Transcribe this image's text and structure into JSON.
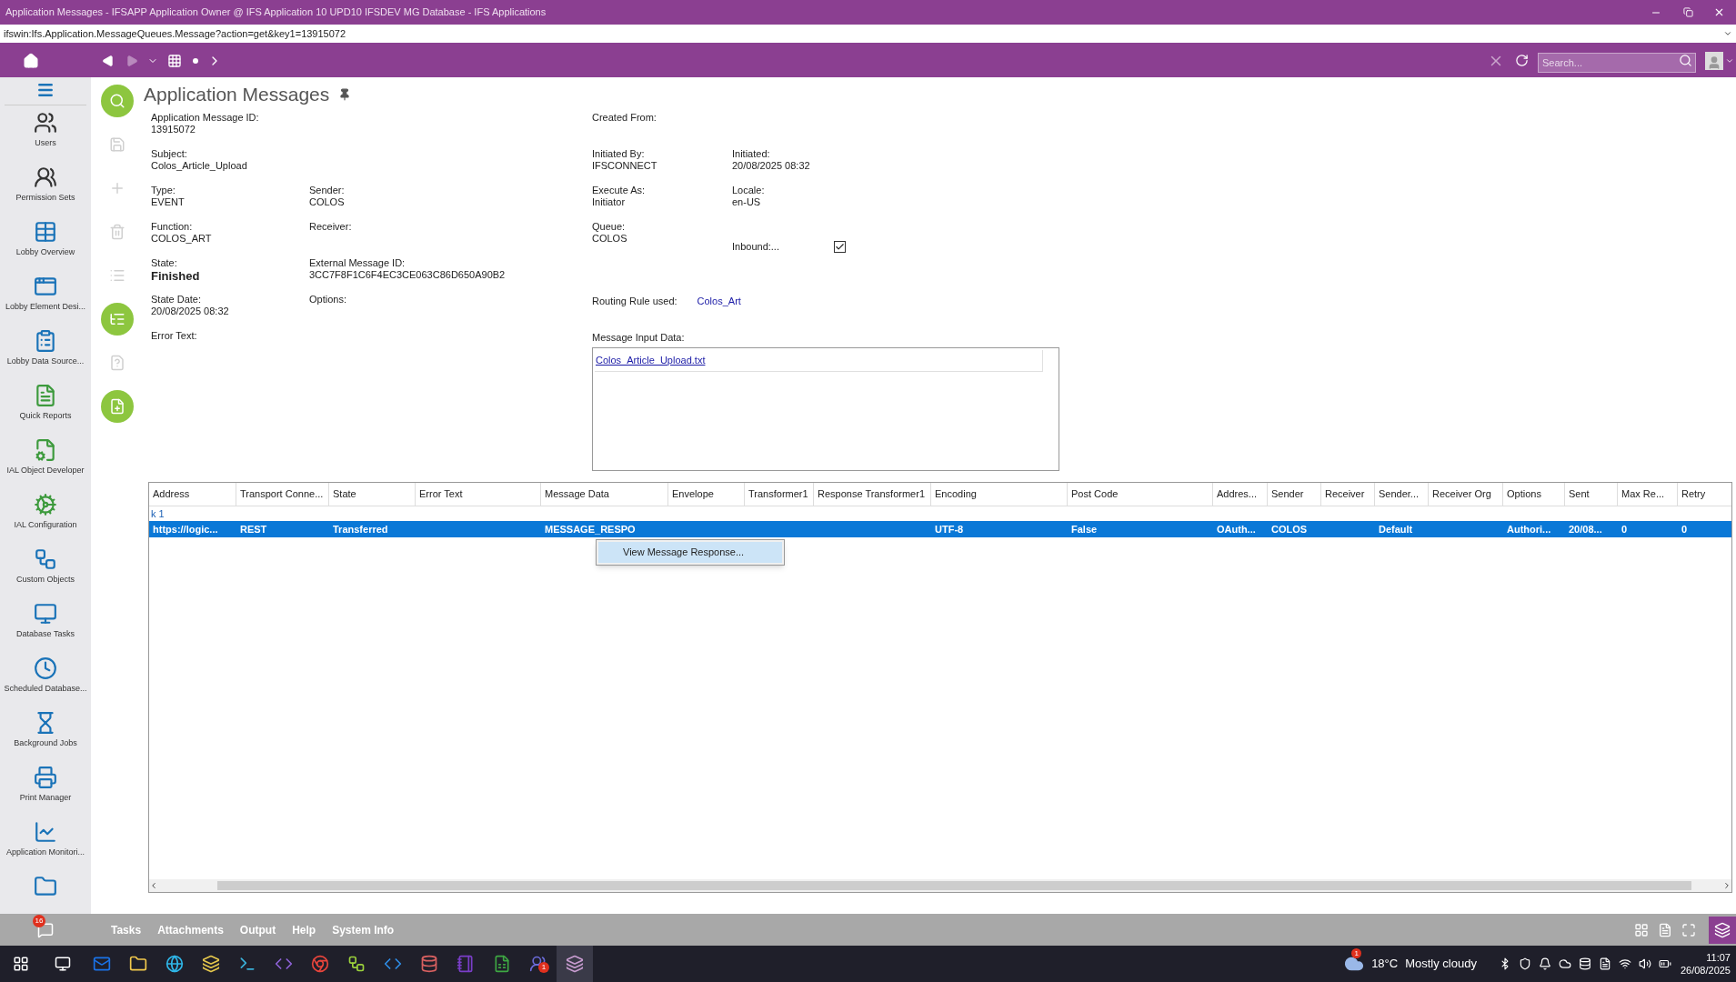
{
  "window": {
    "title": "Application Messages - IFSAPP Application Owner @ IFS Application 10 UPD10 IFSDEV MG Database - IFS Applications"
  },
  "address_bar": {
    "value": "ifswin:Ifs.Application.MessageQueues.Message?action=get&key1=13915072"
  },
  "nav": {
    "forward_disabled": true,
    "search": {
      "placeholder": "Search..."
    }
  },
  "sidebar": {
    "items": [
      {
        "label": "Users"
      },
      {
        "label": "Permission Sets"
      },
      {
        "label": "Lobby Overview"
      },
      {
        "label": "Lobby Element Desi..."
      },
      {
        "label": "Lobby Data Source..."
      },
      {
        "label": "Quick Reports"
      },
      {
        "label": "IAL Object Developer"
      },
      {
        "label": "IAL Configuration"
      },
      {
        "label": "Custom Objects"
      },
      {
        "label": "Database Tasks"
      },
      {
        "label": "Scheduled Database..."
      },
      {
        "label": "Background Jobs"
      },
      {
        "label": "Print Manager"
      },
      {
        "label": "Application Monitori..."
      },
      {
        "kind": "cut"
      }
    ]
  },
  "toolbar": [
    {
      "disabled": false
    },
    {
      "disabled": true
    },
    {
      "disabled": true
    },
    {
      "disabled": true
    },
    {
      "disabled": true
    },
    {
      "disabled": false
    },
    {
      "disabled": true
    },
    {
      "disabled": false
    }
  ],
  "page": {
    "title": "Application Messages"
  },
  "form": {
    "fields": [
      {
        "kind": "text",
        "label": "Application Message ID:",
        "value": "13915072"
      },
      {
        "kind": "text",
        "label": "Created From:"
      },
      {
        "kind": "text",
        "label": "Subject:",
        "value": "Colos_Article_Upload"
      },
      {
        "kind": "text",
        "label": "Initiated By:",
        "value": "IFSCONNECT"
      },
      {
        "kind": "text",
        "label": "Initiated:",
        "value": "20/08/2025 08:32"
      },
      {
        "kind": "text",
        "label": "Type:",
        "value": "EVENT"
      },
      {
        "kind": "text",
        "label": "Sender:",
        "value": "COLOS"
      },
      {
        "kind": "text",
        "label": "Execute As:",
        "value": "Initiator"
      },
      {
        "kind": "text",
        "label": "Locale:",
        "value": "en-US"
      },
      {
        "kind": "text",
        "label": "Function:",
        "value": "COLOS_ART"
      },
      {
        "kind": "text",
        "label": "Receiver:"
      },
      {
        "kind": "text",
        "label": "Queue:",
        "value": "COLOS"
      },
      {
        "kind": "checkbox",
        "label": "Inbound:...",
        "checked": true
      },
      {
        "kind": "bold",
        "label": "State:",
        "value": "Finished"
      },
      {
        "kind": "text",
        "label": "External Message ID:",
        "value": "3CC7F8F1C6F4EC3CE063C86D650A90B2"
      },
      {
        "kind": "text",
        "label": "State Date:",
        "value": "20/08/2025 08:32"
      },
      {
        "kind": "text",
        "label": "Options:"
      },
      {
        "kind": "link",
        "label": "Routing Rule used:",
        "value": "Colos_Art"
      },
      {
        "kind": "text",
        "label": "Error Text:"
      },
      {
        "kind": "attachment",
        "label": "Message Input Data:",
        "value": "Colos_Article_Upload.txt"
      }
    ]
  },
  "table": {
    "columns": [
      "Address",
      "Transport Conne...",
      "State",
      "Error Text",
      "Message Data",
      "Envelope",
      "Transformer1",
      "Response Transformer1",
      "Encoding",
      "Post Code",
      "Addres...",
      "Sender",
      "Receiver",
      "Sender...",
      "Receiver Org",
      "Options",
      "Sent",
      "Max Re...",
      "Retry"
    ],
    "group_label": "k 1",
    "rows": [
      {
        "selected": true,
        "cells": [
          "https://logic...",
          "REST",
          "Transferred",
          "",
          "MESSAGE_RESPO",
          "",
          "",
          "",
          "UTF-8",
          "False",
          "OAuth...",
          "COLOS",
          "",
          "Default",
          "",
          "Authori...",
          "20/08...",
          "0",
          "0"
        ]
      }
    ]
  },
  "context_menu": {
    "items": [
      "View Message Response..."
    ]
  },
  "bottom_bar": {
    "badge": "16",
    "tabs": [
      "Tasks",
      "Attachments",
      "Output",
      "Help",
      "System Info"
    ]
  },
  "taskbar": {
    "weather": {
      "badge": "1",
      "temperature": "18°C",
      "condition": "Mostly cloudy"
    },
    "teams_badge": "1",
    "time": "11:07",
    "date": "26/08/2025"
  }
}
